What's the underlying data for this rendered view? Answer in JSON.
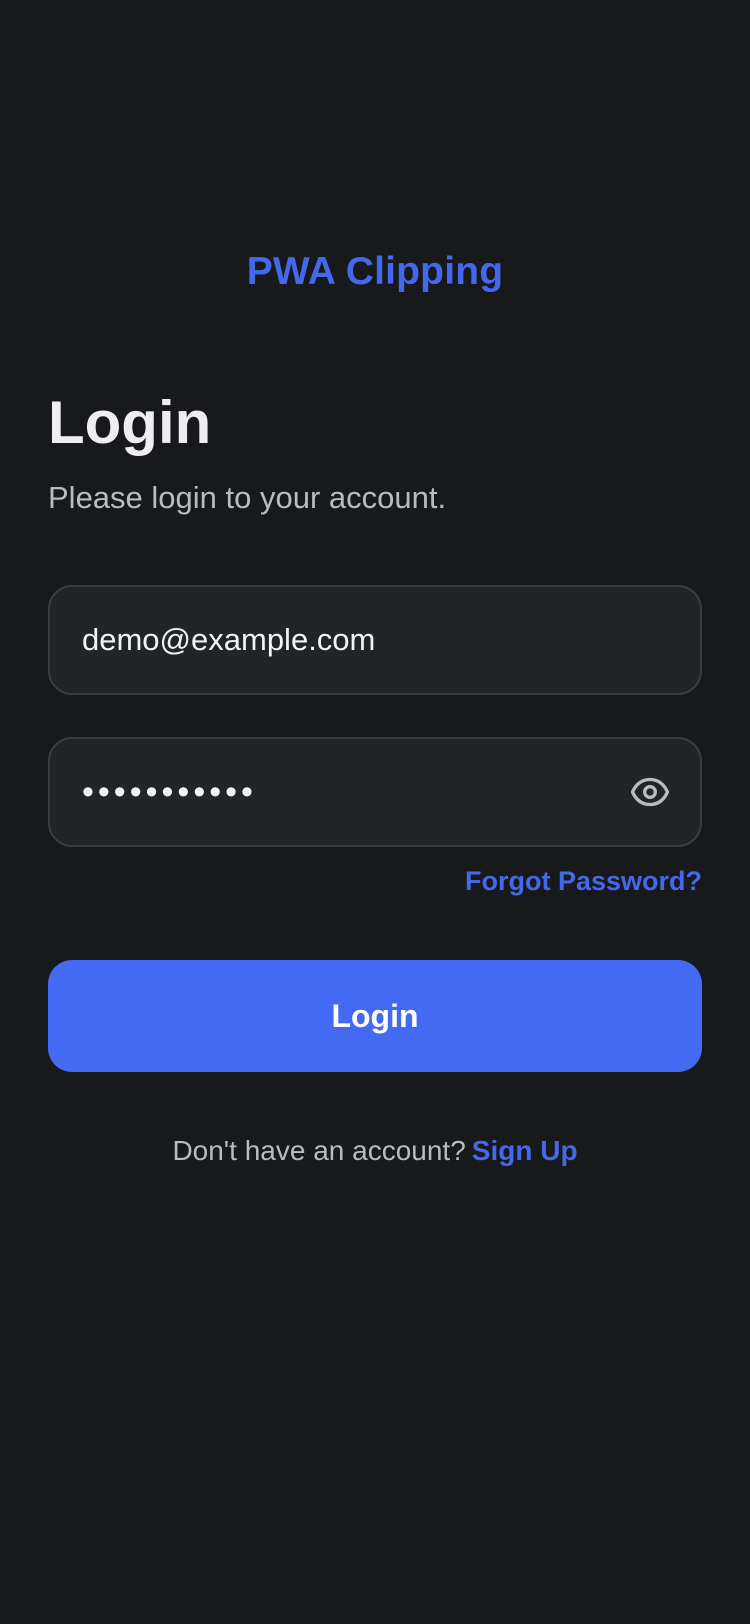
{
  "app": {
    "brand": "PWA Clipping"
  },
  "login": {
    "title": "Login",
    "subtitle": "Please login to your account.",
    "email_value": "demo@example.com",
    "password_value": "•••••••••••",
    "forgot_label": "Forgot Password?",
    "submit_label": "Login",
    "signup_prompt": "Don't have an account?",
    "signup_label": "Sign Up"
  },
  "icons": {
    "password_toggle": "eye-icon"
  },
  "colors": {
    "background": "#18191b",
    "accent": "#4368ea",
    "button": "#4469f2",
    "field_bg": "#232427",
    "field_border": "#3a3c41"
  }
}
